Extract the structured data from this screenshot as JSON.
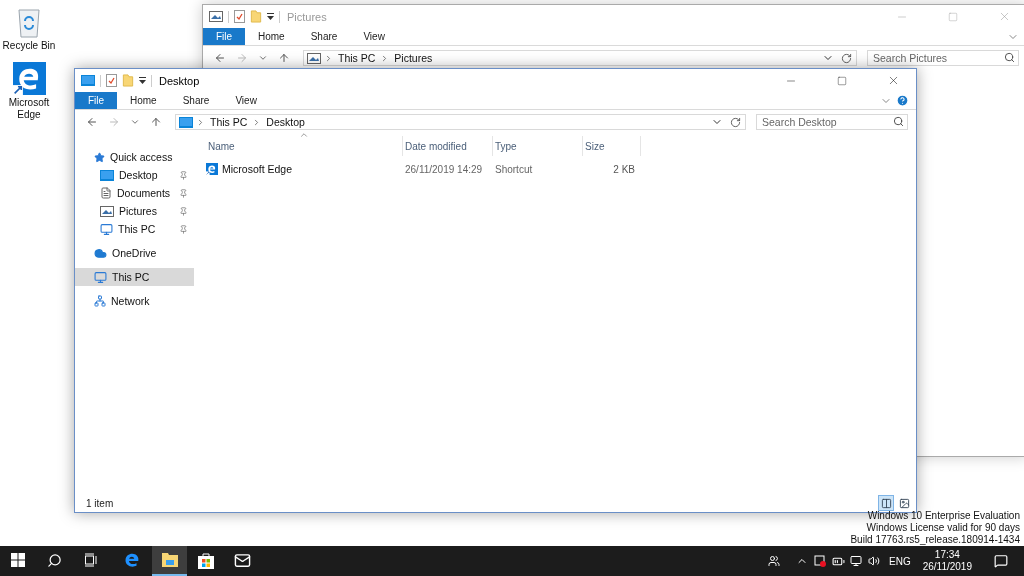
{
  "desktop_icons": [
    {
      "kind": "recycle",
      "label": "Recycle Bin"
    },
    {
      "kind": "edge",
      "label": "Microsoft Edge"
    }
  ],
  "windows": [
    {
      "title": "Pictures",
      "active": false,
      "ribbon_tabs": [
        {
          "kind": "file",
          "label": "File"
        },
        {
          "kind": "tab",
          "label": "Home"
        },
        {
          "kind": "tab",
          "label": "Share"
        },
        {
          "kind": "tab",
          "label": "View"
        }
      ],
      "kind": "pictures",
      "path": [
        "This PC",
        "Pictures"
      ],
      "search": {
        "placeholder": "Search Pictures"
      }
    },
    {
      "title": "Desktop",
      "active": true,
      "help_button": true,
      "ribbon_tabs": [
        {
          "kind": "file",
          "label": "File"
        },
        {
          "kind": "tab",
          "label": "Home"
        },
        {
          "kind": "tab",
          "label": "Share"
        },
        {
          "kind": "tab",
          "label": "View"
        }
      ],
      "kind": "desktop",
      "path": [
        "This PC",
        "Desktop"
      ],
      "search": {
        "placeholder": "Search Desktop"
      },
      "nav": [
        {
          "kind": "star",
          "label": "Quick access",
          "selected": false,
          "children": [
            {
              "kind": "desktop",
              "label": "Desktop",
              "pinned": true,
              "selected": false
            },
            {
              "kind": "documents",
              "label": "Documents",
              "pinned": true,
              "selected": false
            },
            {
              "kind": "pictures",
              "label": "Pictures",
              "pinned": true,
              "selected": false
            },
            {
              "kind": "pc",
              "label": "This PC",
              "pinned": true,
              "selected": false
            }
          ]
        },
        {
          "kind": "cloud",
          "label": "OneDrive",
          "selected": false
        },
        {
          "kind": "pc",
          "label": "This PC",
          "selected": true
        },
        {
          "kind": "network",
          "label": "Network",
          "selected": false
        }
      ],
      "columns": [
        {
          "label": "Name",
          "sorted": true
        },
        {
          "label": "Date modified",
          "sorted": false
        },
        {
          "label": "Type",
          "sorted": false
        },
        {
          "label": "Size",
          "sorted": false
        }
      ],
      "rows": [
        {
          "name": "Microsoft Edge",
          "date": "26/11/2019 14:29",
          "type": "Shortcut",
          "size": "2 KB"
        }
      ],
      "status": "1 item",
      "views": [
        {
          "kind": "details",
          "selected": true
        },
        {
          "kind": "large",
          "selected": false
        }
      ]
    }
  ],
  "system_notice": [
    "Windows 10 Enterprise Evaluation",
    "Windows License valid for 90 days",
    "Build 17763.rs5_release.180914-1434"
  ],
  "taskbar": {
    "apps": [
      {
        "kind": "start",
        "selected": false
      },
      {
        "kind": "search",
        "selected": false
      },
      {
        "kind": "taskview",
        "selected": false
      },
      {
        "kind": "edge",
        "selected": false
      },
      {
        "kind": "explorer",
        "selected": true
      },
      {
        "kind": "store",
        "selected": false
      },
      {
        "kind": "mail",
        "selected": false
      }
    ],
    "tray_icons": [
      {
        "kind": "people"
      },
      {
        "kind": "chevron"
      },
      {
        "kind": "alert"
      },
      {
        "kind": "battery"
      },
      {
        "kind": "network"
      },
      {
        "kind": "volume"
      }
    ],
    "language": "ENG",
    "time": "17:34",
    "date": "26/11/2019"
  }
}
